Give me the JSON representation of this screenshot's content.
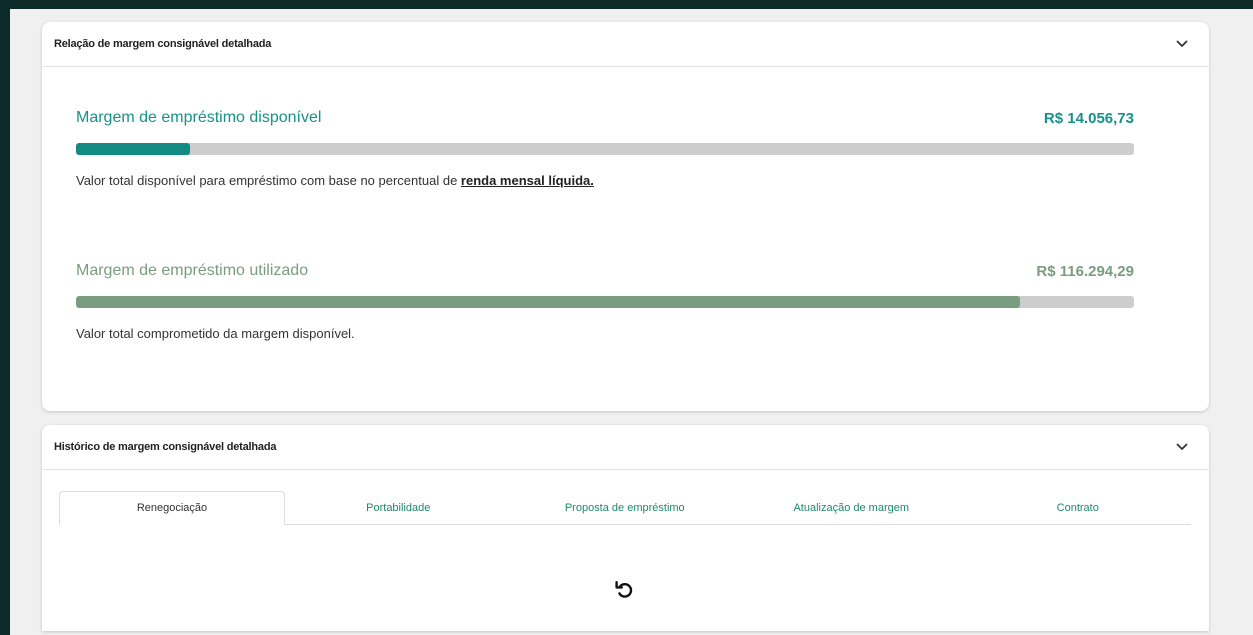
{
  "margin_card": {
    "title": "Relação de margem consignável detalhada",
    "available": {
      "label": "Margem de empréstimo disponível",
      "value": "R$ 14.056,73",
      "progress_percent": 10.8,
      "description": "Valor total disponível para empréstimo com base no percentual de ",
      "link_text": "renda mensal líquida."
    },
    "used": {
      "label": "Margem de empréstimo utilizado",
      "value": "R$ 116.294,29",
      "progress_percent": 89.2,
      "description": "Valor total comprometido da margem disponível."
    }
  },
  "history_card": {
    "title": "Histórico de margem consignável detalhada",
    "tabs": [
      {
        "label": "Renegociação",
        "active": true
      },
      {
        "label": "Portabilidade",
        "active": false
      },
      {
        "label": "Proposta de empréstimo",
        "active": false
      },
      {
        "label": "Atualização de margem",
        "active": false
      },
      {
        "label": "Contrato",
        "active": false
      }
    ]
  },
  "colors": {
    "accent_teal": "#138a83",
    "accent_sage": "#7a9c80",
    "tab_text": "#1d8a6a",
    "frame": "#0c2b28"
  },
  "icons": {
    "collapse": "chevron-down-icon",
    "reload": "reload-icon"
  }
}
